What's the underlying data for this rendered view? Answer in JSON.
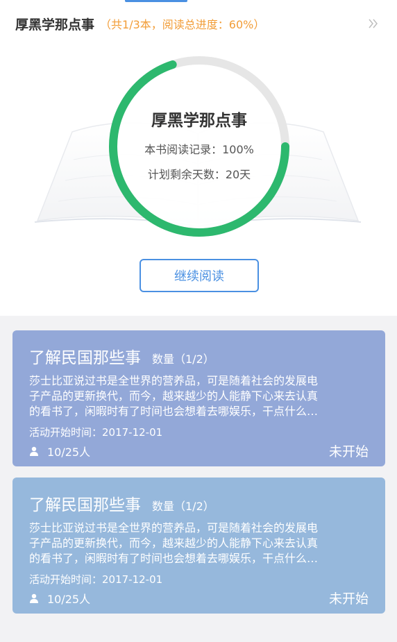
{
  "header": {
    "title": "厚黑学那点事",
    "subtitle": "（共1/3本，阅读总进度：60%）"
  },
  "progress": {
    "book_title": "厚黑学那点事",
    "record_text": "本书阅读记录：100%",
    "days_text": "计划剩余天数：20天",
    "ring_fraction": 0.7
  },
  "actions": {
    "continue_label": "继续阅读"
  },
  "cards": [
    {
      "title": "了解民国那些事",
      "count": "数量（1/2）",
      "desc_lines": [
        "莎士比亚说过书是全世界的营养品，可是随着社会的发展电",
        "子产品的更新换代，而今，越来越少的人能静下心来去认真",
        "的看书了，闲暇时有了时间也会想着去哪娱乐，干点什么…"
      ],
      "date": "活动开始时间：2017-12-01",
      "people": "10/25人",
      "status": "未开始",
      "color": "#93a8d8"
    },
    {
      "title": "了解民国那些事",
      "count": "数量（1/2）",
      "desc_lines": [
        "莎士比亚说过书是全世界的营养品，可是随着社会的发展电",
        "子产品的更新换代，而今，越来越少的人能静下心来去认真",
        "的看书了，闲暇时有了时间也会想着去哪娱乐，干点什么…"
      ],
      "date": "活动开始时间：2017-12-01",
      "people": "10/25人",
      "status": "未开始",
      "color": "#96b8dc"
    }
  ],
  "colors": {
    "progress_green": "#2db86e",
    "track_gray": "#e6e6e6",
    "accent_blue": "#4a90e2",
    "subtitle_orange": "#f29d38"
  }
}
